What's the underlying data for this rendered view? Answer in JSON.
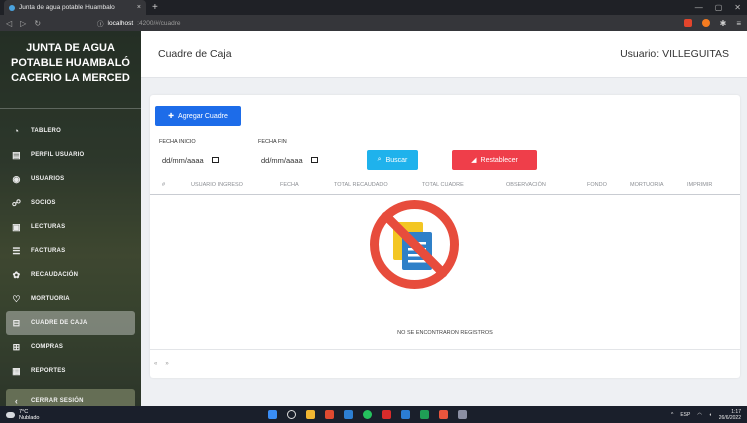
{
  "browser": {
    "tab_title": "Junta de agua potable Huambalo",
    "tab_close": "×",
    "new_tab": "+",
    "url_host": "localhost",
    "url_path": ":4200/#/cuadre"
  },
  "sidebar": {
    "brand": "JUNTA DE AGUA POTABLE HUAMBALÓ CACERIO LA MERCED",
    "items": [
      {
        "label": "TABLERO",
        "icon": "dashboard-icon"
      },
      {
        "label": "PERFIL USUARIO",
        "icon": "id-card-icon"
      },
      {
        "label": "USUARIOS",
        "icon": "users-icon"
      },
      {
        "label": "SOCIOS",
        "icon": "partners-icon"
      },
      {
        "label": "LECTURAS",
        "icon": "meter-icon"
      },
      {
        "label": "FACTURAS",
        "icon": "invoice-icon"
      },
      {
        "label": "RECAUDACIÓN",
        "icon": "collection-icon"
      },
      {
        "label": "MORTUORIA",
        "icon": "heart-icon"
      },
      {
        "label": "CUADRE DE CAJA",
        "icon": "cash-register-icon"
      },
      {
        "label": "COMPRAS",
        "icon": "purchases-icon"
      },
      {
        "label": "REPORTES",
        "icon": "reports-icon"
      }
    ],
    "logout": "CERRAR SESIÓN"
  },
  "header": {
    "title": "Cuadre de Caja",
    "user": "Usuario: VILLEGUITAS"
  },
  "toolbar": {
    "add_label": "Agregar Cuadre",
    "start_label": "FECHA INICIO",
    "start_placeholder": "dd/mm/aaaa",
    "end_label": "FECHA FIN",
    "end_placeholder": "dd/mm/aaaa",
    "search_label": "Buscar",
    "reset_label": "Restablecer"
  },
  "table": {
    "columns": [
      "#",
      "USUARIO INGRESO",
      "FECHA",
      "TOTAL RECAUDADO",
      "TOTAL CUADRE",
      "OBSERVACIÓN",
      "FONDO",
      "MORTUORIA",
      "IMPRIMIR"
    ],
    "empty_message": "NO SE ENCONTRARON REGISTROS"
  },
  "pager": {
    "prev": "«",
    "next": "»"
  },
  "taskbar": {
    "temperature": "7°C",
    "weather": "Nublado",
    "language": "ESP",
    "time": "1:17",
    "date": "26/6/2022"
  },
  "colors": {
    "primary": "#1d6ce9",
    "info": "#1fb2ec",
    "danger": "#ef3e4a",
    "no_sign": "#e74c3c"
  }
}
